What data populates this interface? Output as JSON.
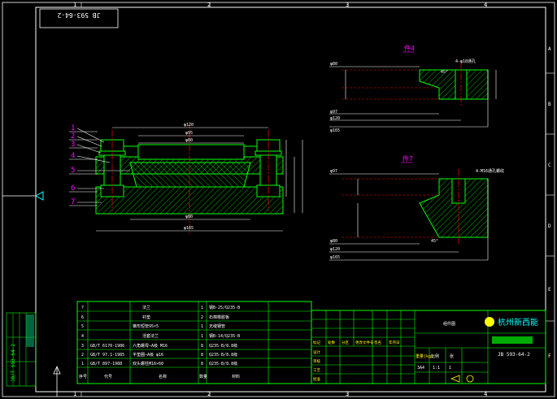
{
  "drawing_number_rotated": "JB 593-64-2",
  "drawing_number": "JB 593-64-2",
  "border_numbers": [
    "1",
    "2",
    "3",
    "4"
  ],
  "border_letters": [
    "A",
    "B",
    "C",
    "D",
    "E",
    "F"
  ],
  "section_labels": {
    "top": "件4",
    "bottom": "件7"
  },
  "part_callouts": [
    "1",
    "2",
    "3",
    "4",
    "5",
    "6",
    "7"
  ],
  "main_dims": {
    "d120": "φ120",
    "d95": "φ95",
    "d80": "φ80",
    "d80b": "φ80",
    "d165": "φ165"
  },
  "detail_top": {
    "d80": "φ80",
    "d97": "φ97",
    "d120": "φ120",
    "d165": "φ165",
    "angle": "45°",
    "note": "4-φ18通孔"
  },
  "detail_bottom": {
    "d97": "φ97",
    "d80": "φ80",
    "d120": "φ120",
    "d165": "φ165",
    "angle": "45°",
    "note": "4-M16通孔螺纹"
  },
  "bom_rows": [
    {
      "no": "7",
      "code": "",
      "name": "法兰",
      "qty": "1",
      "material": "钢B-25/Q235-B"
    },
    {
      "no": "6",
      "code": "",
      "name": "衬垫",
      "qty": "2",
      "material": "石棉橡胶板"
    },
    {
      "no": "5",
      "code": "",
      "name": "锥形短管95×5",
      "qty": "1",
      "material": "无缝钢管"
    },
    {
      "no": "4",
      "code": "",
      "name": "活套法兰",
      "qty": "1",
      "material": "钢B-14/Q235-B"
    },
    {
      "no": "3",
      "code": "GB/T 6170-1986",
      "name": "六角螺母—A级 M16",
      "qty": "8",
      "material": "Q235-B/8.8级"
    },
    {
      "no": "2",
      "code": "GB/T 97.1-1985",
      "name": "平垫圈—A级 φ16",
      "qty": "8",
      "material": "Q235-B/8.8级"
    },
    {
      "no": "1",
      "code": "GB/T 897-1988",
      "name": "双头螺柱M16×60",
      "qty": "8",
      "material": "Q235-B/8.8级"
    }
  ],
  "bom_header": {
    "no": "序号",
    "code": "代号",
    "name": "名称",
    "qty": "数量",
    "material": "材料"
  },
  "title_block": {
    "company": "杭州新西能",
    "assembly_name": "组件图",
    "unit_label": "重量(kg)",
    "scale_label": "比例",
    "sheet_label": "张",
    "scale": "1:1",
    "sheet": "1",
    "format": "3A4",
    "sign_cells": [
      "标记",
      "处数",
      "分区",
      "更改文件号",
      "签名",
      "年月日"
    ],
    "design_rows": [
      "设计",
      "审核",
      "工艺",
      "批准"
    ]
  },
  "side_stamp": "JB/T 593-64-2",
  "colors": {
    "frame": "#ffffff",
    "outline": "#00ff00",
    "hatch": "#00ff00",
    "text": "#ffffff",
    "callout": "#ff00ff",
    "dim": "#ffffff",
    "center": "#ff0000",
    "accent": "#ffff00",
    "company": "#00ffff"
  }
}
